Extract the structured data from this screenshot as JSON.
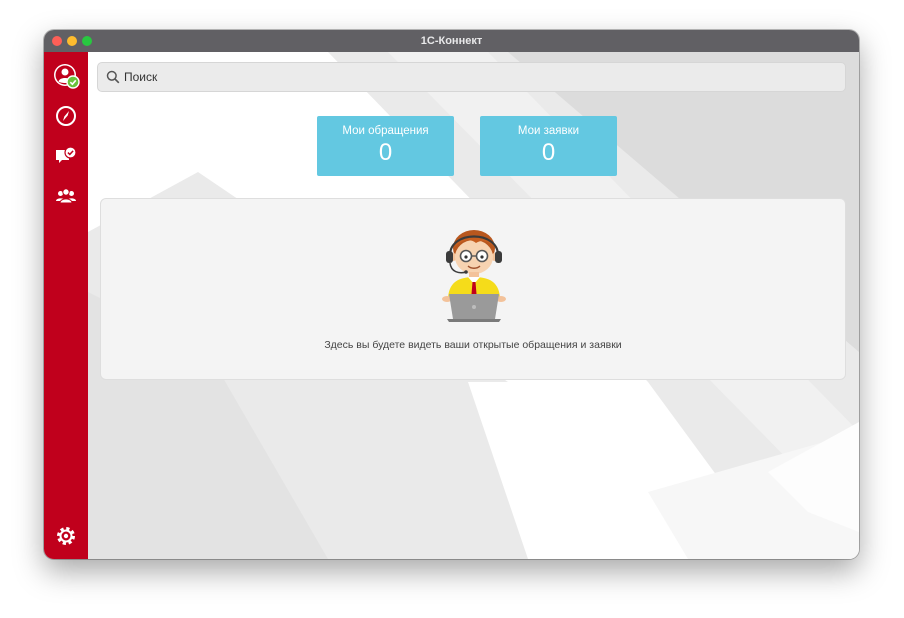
{
  "window": {
    "title": "1С-Коннект"
  },
  "sidebar": {
    "items": [
      {
        "name": "profile",
        "icon": "avatar-online-icon"
      },
      {
        "name": "navigator",
        "icon": "compass-icon"
      },
      {
        "name": "support-requests",
        "icon": "chat-check-icon"
      },
      {
        "name": "contacts",
        "icon": "users-group-icon"
      }
    ],
    "settings_icon": "gear-icon"
  },
  "search": {
    "placeholder": "Поиск",
    "value": ""
  },
  "stats": [
    {
      "label": "Мои обращения",
      "value": "0"
    },
    {
      "label": "Мои заявки",
      "value": "0"
    }
  ],
  "empty_state": {
    "illustration": "support-operator-illustration",
    "text": "Здесь вы будете видеть ваши открытые обращения и заявки"
  },
  "colors": {
    "sidebar": "#c0001c",
    "stat_tile": "#63c8e1",
    "titlebar": "#616064",
    "status_online": "#6ac33c"
  }
}
